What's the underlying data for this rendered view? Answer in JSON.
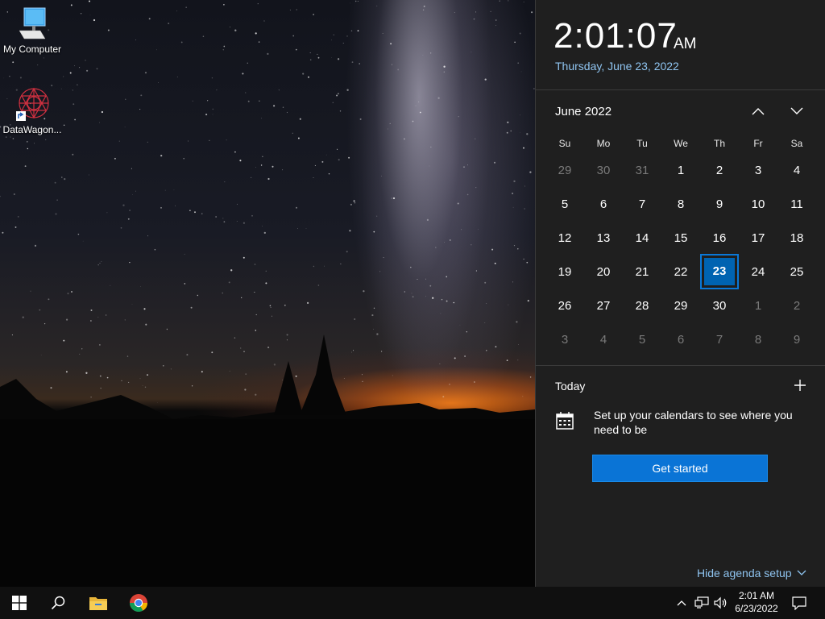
{
  "desktop": {
    "icons": [
      {
        "label": "My Computer",
        "icon": "computer-icon"
      },
      {
        "label": "DataWagon...",
        "icon": "datawagon-shortcut-icon"
      }
    ]
  },
  "flyout": {
    "time": "2:01:07",
    "ampm": "AM",
    "date": "Thursday, June 23, 2022",
    "month_label": "June 2022",
    "weekdays": [
      "Su",
      "Mo",
      "Tu",
      "We",
      "Th",
      "Fr",
      "Sa"
    ],
    "weeks": [
      [
        "29",
        "30",
        "31",
        "1",
        "2",
        "3",
        "4"
      ],
      [
        "5",
        "6",
        "7",
        "8",
        "9",
        "10",
        "11"
      ],
      [
        "12",
        "13",
        "14",
        "15",
        "16",
        "17",
        "18"
      ],
      [
        "19",
        "20",
        "21",
        "22",
        "23",
        "24",
        "25"
      ],
      [
        "26",
        "27",
        "28",
        "29",
        "30",
        "1",
        "2"
      ],
      [
        "3",
        "4",
        "5",
        "6",
        "7",
        "8",
        "9"
      ]
    ],
    "selected_day": "23",
    "today_label": "Today",
    "agenda_text": "Set up your calendars to see where you need to be",
    "get_started_label": "Get started",
    "hide_agenda_label": "Hide agenda setup",
    "accent_color": "#0063b1",
    "link_color": "#8fc4f0"
  },
  "taskbar": {
    "time": "2:01 AM",
    "date": "6/23/2022",
    "apps": [
      "windows-start-icon",
      "search-icon",
      "file-explorer-icon",
      "chrome-icon"
    ]
  }
}
